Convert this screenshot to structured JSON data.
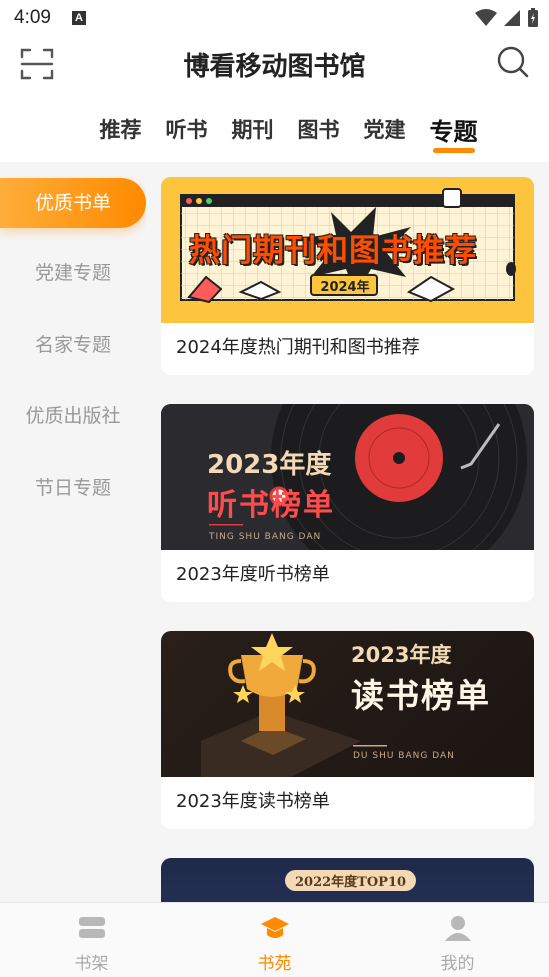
{
  "status": {
    "time": "4:09",
    "a_badge": "A"
  },
  "header": {
    "title": "博看移动图书馆",
    "scan_icon": "scan-icon",
    "search_icon": "search-icon"
  },
  "tabs": [
    {
      "label": "推荐",
      "active": false
    },
    {
      "label": "听书",
      "active": false
    },
    {
      "label": "期刊",
      "active": false
    },
    {
      "label": "图书",
      "active": false
    },
    {
      "label": "党建",
      "active": false
    },
    {
      "label": "专题",
      "active": true
    }
  ],
  "sidebar": {
    "items": [
      {
        "label": "优质书单",
        "active": true
      },
      {
        "label": "党建专题",
        "active": false
      },
      {
        "label": "名家专题",
        "active": false
      },
      {
        "label": "优质出版社",
        "active": false
      },
      {
        "label": "节日专题",
        "active": false
      }
    ]
  },
  "cards": [
    {
      "title": "2024年度热门期刊和图书推荐",
      "banner_text": "热门期刊和图书推荐",
      "banner_badge": "2024年"
    },
    {
      "title": "2023年度听书榜单",
      "banner_year": "2023年度",
      "banner_text": "听书榜单",
      "banner_sub": "TING SHU BANG DAN"
    },
    {
      "title": "2023年度读书榜单",
      "banner_year": "2023年度",
      "banner_text": "读书榜单",
      "banner_sub": "DU SHU BANG DAN"
    },
    {
      "title": "",
      "banner_badge": "2022年度TOP10"
    }
  ],
  "bottom_nav": [
    {
      "label": "书架",
      "icon": "bookshelf-icon",
      "active": false
    },
    {
      "label": "书苑",
      "icon": "graduation-cap-icon",
      "active": true
    },
    {
      "label": "我的",
      "icon": "person-icon",
      "active": false
    }
  ],
  "colors": {
    "accent": "#ff8a00",
    "sidebar_bg": "#f5f5f5"
  }
}
